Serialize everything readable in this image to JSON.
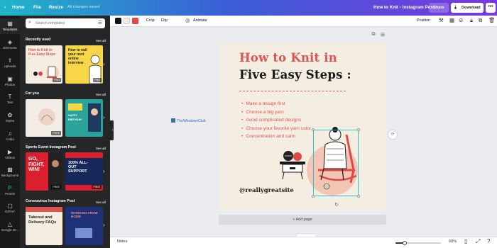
{
  "topbar": {
    "home": "Home",
    "file": "File",
    "resize": "Resize",
    "saved_status": "All changes saved",
    "doc_title": "How to Knit - Instagram Post",
    "share": "Share",
    "download": "Download",
    "more": "•••",
    "gradient_colors": [
      "#20b6c8",
      "#3a5ed6",
      "#7a38e0"
    ]
  },
  "rail": {
    "items": [
      {
        "label": "Templates",
        "icon": "templates-icon",
        "glyph": "▦"
      },
      {
        "label": "Elements",
        "icon": "elements-icon",
        "glyph": "◈"
      },
      {
        "label": "Uploads",
        "icon": "upload-icon",
        "glyph": "⇪"
      },
      {
        "label": "Photos",
        "icon": "photo-icon",
        "glyph": "▣"
      },
      {
        "label": "Text",
        "icon": "text-icon",
        "glyph": "T"
      },
      {
        "label": "Styles",
        "icon": "styles-icon",
        "glyph": "✿"
      },
      {
        "label": "Audio",
        "icon": "audio-icon",
        "glyph": "♫"
      },
      {
        "label": "Videos",
        "icon": "video-icon",
        "glyph": "▶"
      },
      {
        "label": "Background",
        "icon": "background-icon",
        "glyph": "▩"
      },
      {
        "label": "Pexels",
        "icon": "pexels-icon",
        "glyph": "P"
      },
      {
        "label": "GIPHY",
        "icon": "giphy-icon",
        "glyph": "▢"
      },
      {
        "label": "Google Dr...",
        "icon": "google-drive-icon",
        "glyph": "△"
      }
    ]
  },
  "panel": {
    "search_placeholder": "Search templates",
    "see_all": "See all",
    "sections": [
      {
        "title": "Recently used"
      },
      {
        "title": "For you"
      },
      {
        "title": "Sports Event Instagram Post"
      },
      {
        "title": "Coronavirus Instagram Post"
      }
    ],
    "thumbs": {
      "knit": "How to Knit in Five Easy Steps :",
      "nail": "How to nail your next online interview",
      "promo": "HAPPY BIRTHDAY",
      "gofight": "GO, FIGHT, WIN!",
      "support": "100% ALL-OUT SUPPORT",
      "takeout": "Takeout and Delivery FAQs",
      "wfh": "WORKING FROM HOME",
      "badge_pro": "PRO",
      "badge_free": "FREE"
    }
  },
  "toolbar": {
    "colors": [
      "#111111",
      "#f3ede2",
      "#e04848"
    ],
    "crop": "Crop",
    "flip": "Flip",
    "animate": "Animate",
    "position": "Position"
  },
  "design": {
    "title_line1": "How to Knit in",
    "title_line2": "Five Easy Steps :",
    "steps": [
      "Make a design first",
      "Choose a big yarn",
      "Avoid complicated designs",
      "Choose your favorite yarn color",
      "Concentration and calm"
    ],
    "handle": "@reallygreatsite",
    "watermark": "TheWindowsClub",
    "accent": "#e05450",
    "background": "#f3ede2"
  },
  "canvas": {
    "add_page": "+ Add page"
  },
  "bottombar": {
    "notes": "Notes",
    "zoom": "60%",
    "zoom_level": 0.6
  }
}
